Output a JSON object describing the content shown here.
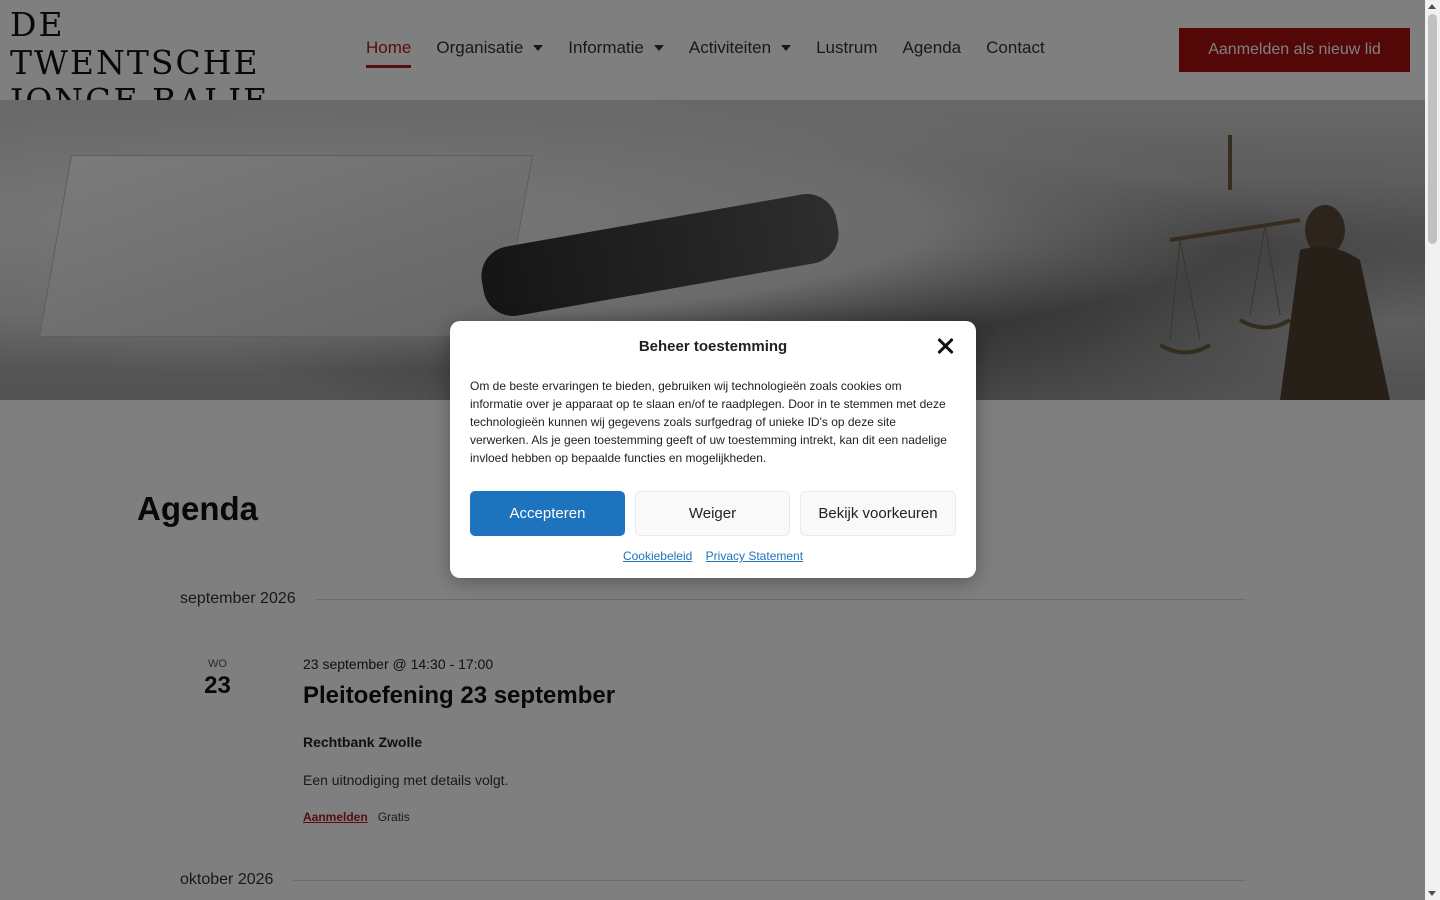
{
  "header": {
    "logo_line1": "De Twentsche",
    "logo_line2": "Jonge Balie",
    "nav": [
      {
        "label": "Home",
        "active": true,
        "dropdown": false
      },
      {
        "label": "Organisatie",
        "active": false,
        "dropdown": true
      },
      {
        "label": "Informatie",
        "active": false,
        "dropdown": true
      },
      {
        "label": "Activiteiten",
        "active": false,
        "dropdown": true
      },
      {
        "label": "Lustrum",
        "active": false,
        "dropdown": false
      },
      {
        "label": "Agenda",
        "active": false,
        "dropdown": false
      },
      {
        "label": "Contact",
        "active": false,
        "dropdown": false
      }
    ],
    "cta_label": "Aanmelden als nieuw lid"
  },
  "colors": {
    "accent": "#b01a1a",
    "cta_bg": "#a60f0f",
    "primary_button": "#1e73be"
  },
  "page": {
    "title": "Agenda",
    "months": [
      "september 2026",
      "oktober 2026"
    ],
    "event": {
      "dow": "WO",
      "day": "23",
      "when": "23 september @ 14:30 - 17:00",
      "title": "Pleitoefening 23 september",
      "venue": "Rechtbank Zwolle",
      "description": "Een uitnodiging met details volgt.",
      "signup_label": "Aanmelden",
      "price": "Gratis"
    }
  },
  "modal": {
    "title": "Beheer toestemming",
    "body": "Om de beste ervaringen te bieden, gebruiken wij technologieën zoals cookies om informatie over je apparaat op te slaan en/of te raadplegen. Door in te stemmen met deze technologieën kunnen wij gegevens zoals surfgedrag of unieke ID's op deze site verwerken. Als je geen toestemming geeft of uw toestemming intrekt, kan dit een nadelige invloed hebben op bepaalde functies en mogelijkheden.",
    "accept_label": "Accepteren",
    "deny_label": "Weiger",
    "preferences_label": "Bekijk voorkeuren",
    "links": [
      "Cookiebeleid",
      "Privacy Statement"
    ],
    "close_icon": "close-icon"
  }
}
